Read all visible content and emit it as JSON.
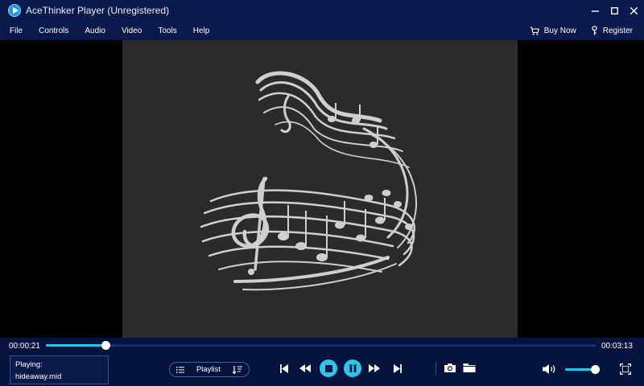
{
  "window": {
    "title": "AceThinker Player (Unregistered)"
  },
  "menu": {
    "items": [
      "File",
      "Controls",
      "Audio",
      "Video",
      "Tools",
      "Help"
    ],
    "buy_now": "Buy Now",
    "register": "Register"
  },
  "player": {
    "current_time": "00:00:21",
    "total_time": "00:03:13",
    "progress_fraction": 0.108,
    "volume_fraction": 0.9,
    "now_playing_label": "Playing:",
    "file_name": "hideaway.mid",
    "playlist_label": "Playlist"
  },
  "colors": {
    "title_bg": "#0a1a4a",
    "control_bg": "#06133d",
    "accent": "#2bc7e8"
  }
}
